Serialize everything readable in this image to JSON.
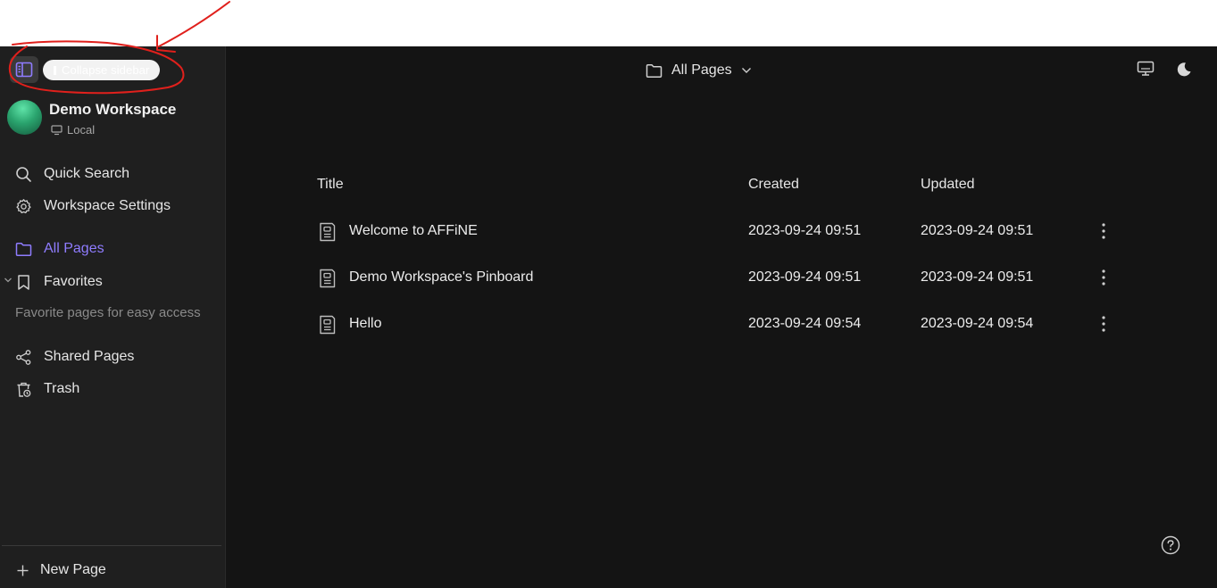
{
  "sidebar": {
    "collapse_tooltip": "Collapse sidebar",
    "workspace": {
      "name": "Demo Workspace",
      "storage": "Local"
    },
    "nav": {
      "quick_search": "Quick Search",
      "workspace_settings": "Workspace Settings",
      "all_pages": "All Pages",
      "favorites": "Favorites",
      "favorites_empty": "Favorite pages for easy access",
      "shared_pages": "Shared Pages",
      "trash": "Trash"
    },
    "new_page": "New Page"
  },
  "header": {
    "title": "All Pages"
  },
  "table": {
    "headers": {
      "title": "Title",
      "created": "Created",
      "updated": "Updated"
    },
    "rows": [
      {
        "title": "Welcome to AFFiNE",
        "created": "2023-09-24 09:51",
        "updated": "2023-09-24 09:51"
      },
      {
        "title": "Demo Workspace's Pinboard",
        "created": "2023-09-24 09:51",
        "updated": "2023-09-24 09:51"
      },
      {
        "title": "Hello",
        "created": "2023-09-24 09:54",
        "updated": "2023-09-24 09:54"
      }
    ]
  },
  "icons": {
    "sidebar_toggle": "sidebar-toggle-icon",
    "search": "search-icon",
    "settings": "gear-icon",
    "all_pages": "folder-icon",
    "favorites": "bookmark-icon",
    "shared": "share-icon",
    "trash": "trash-icon",
    "new_page": "plus-icon",
    "page": "page-icon",
    "more": "more-vertical-icon",
    "monitor": "monitor-icon",
    "theme": "moon-icon",
    "help": "help-icon"
  },
  "colors": {
    "accent": "#8f7cff",
    "sidebar_bg": "#1f1f1f",
    "main_bg": "#141414",
    "annotation": "#e0201c"
  }
}
